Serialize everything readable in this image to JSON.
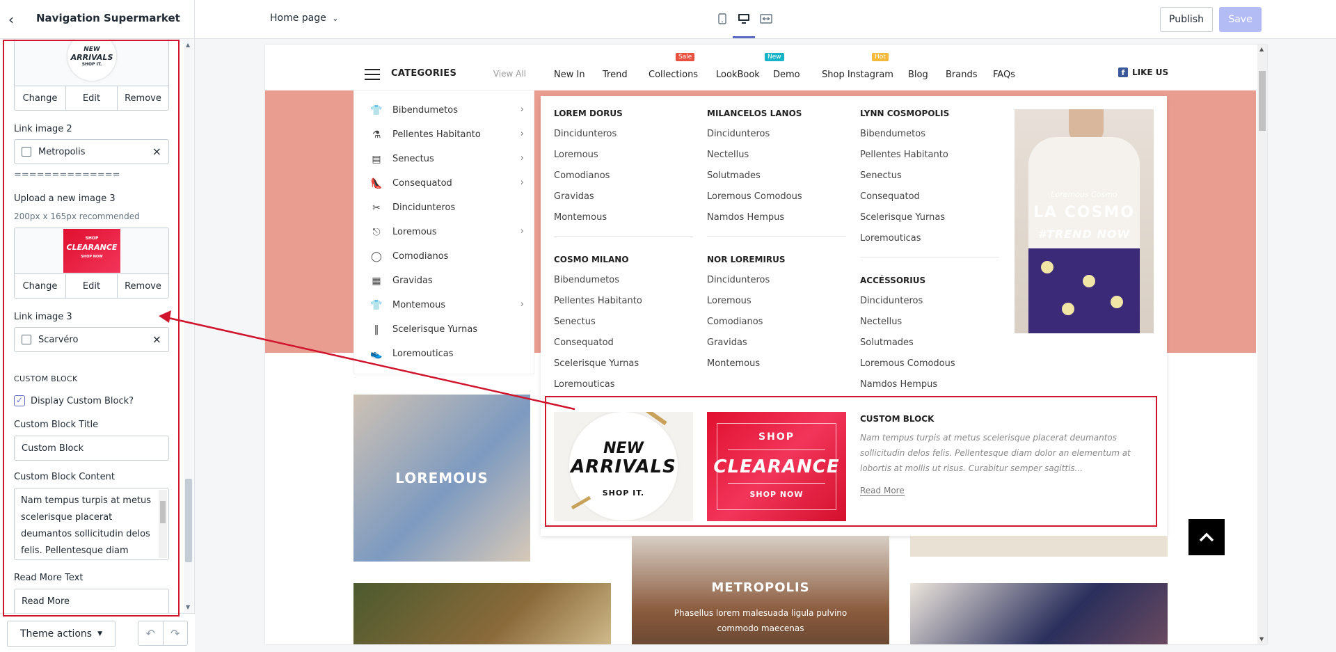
{
  "sidebar": {
    "title": "Navigation Supermarket",
    "image1_buttons": [
      "Change",
      "Edit",
      "Remove"
    ],
    "link_image_2_label": "Link image 2",
    "link_image_2_value": "Metropolis",
    "separator": "==============",
    "upload_image_3_label": "Upload a new image 3",
    "upload_image_3_hint": "200px x 165px recommended",
    "image3_buttons": [
      "Change",
      "Edit",
      "Remove"
    ],
    "link_image_3_label": "Link image 3",
    "link_image_3_value": "Scarvéro",
    "custom_block_heading": "CUSTOM BLOCK",
    "display_custom_block_label": "Display Custom Block?",
    "display_custom_block_checked": true,
    "custom_block_title_label": "Custom Block Title",
    "custom_block_title_value": "Custom Block",
    "custom_block_content_label": "Custom Block Content",
    "custom_block_content_value": "Nam tempus turpis at metus scelerisque placerat deumantos sollicitudin delos felis. Pellentesque diam dolor",
    "read_more_label": "Read More Text",
    "read_more_value": "Read More",
    "theme_actions": "Theme actions"
  },
  "topbar": {
    "page_select": "Home page",
    "publish": "Publish",
    "save": "Save",
    "active_device": "desktop"
  },
  "preview": {
    "categories_title": "CATEGORIES",
    "view_all": "View All",
    "categories": [
      {
        "label": "Bibendumetos",
        "arrow": true
      },
      {
        "label": "Pellentes Habitanto",
        "arrow": true
      },
      {
        "label": "Senectus",
        "arrow": true
      },
      {
        "label": "Consequatod",
        "arrow": true
      },
      {
        "label": "Dincidunteros",
        "arrow": false
      },
      {
        "label": "Loremous",
        "arrow": true
      },
      {
        "label": "Comodianos",
        "arrow": false
      },
      {
        "label": "Gravidas",
        "arrow": false
      },
      {
        "label": "Montemous",
        "arrow": true
      },
      {
        "label": "Scelerisque Yurnas",
        "arrow": false
      },
      {
        "label": "Loremouticas",
        "arrow": false
      }
    ],
    "nav": [
      {
        "label": "New In",
        "badge": ""
      },
      {
        "label": "Trend",
        "badge": ""
      },
      {
        "label": "Collections",
        "badge": "Sale"
      },
      {
        "label": "LookBook",
        "badge": ""
      },
      {
        "label": "Demo",
        "badge": "New"
      },
      {
        "label": "Shop Instagram",
        "badge": "Hot"
      },
      {
        "label": "Blog",
        "badge": ""
      },
      {
        "label": "Brands",
        "badge": ""
      },
      {
        "label": "FAQs",
        "badge": ""
      }
    ],
    "badge_colors": {
      "Sale": "#e8503f",
      "New": "#17b3c8",
      "Hot": "#f5b93b"
    },
    "like_us": "LIKE US",
    "mega_columns": [
      {
        "groups": [
          {
            "title": "LOREM DORUS",
            "items": [
              "Dincidunteros",
              "Loremous",
              "Comodianos",
              "Gravidas",
              "Montemous"
            ]
          },
          {
            "title": "COSMO MILANO",
            "items": [
              "Bibendumetos",
              "Pellentes Habitanto",
              "Senectus",
              "Consequatod",
              "Scelerisque Yurnas",
              "Loremouticas"
            ]
          }
        ]
      },
      {
        "groups": [
          {
            "title": "MILANCELOS LANOS",
            "items": [
              "Dincidunteros",
              "Nectellus",
              "Solutmades",
              "Loremous Comodous",
              "Namdos Hempus"
            ]
          },
          {
            "title": "NOR LOREMIRUS",
            "items": [
              "Dincidunteros",
              "Loremous",
              "Comodianos",
              "Gravidas",
              "Montemous"
            ]
          }
        ]
      },
      {
        "groups": [
          {
            "title": "LYNN COSMOPOLIS",
            "items": [
              "Bibendumetos",
              "Pellentes Habitanto",
              "Senectus",
              "Consequatod",
              "Scelerisque Yurnas",
              "Loremouticas"
            ]
          },
          {
            "title": "ACCÉSSORIUS",
            "items": [
              "Dincidunteros",
              "Nectellus",
              "Solutmades",
              "Loremous Comodous",
              "Namdos Hempus"
            ]
          }
        ]
      }
    ],
    "mega_image": {
      "small": "Loremous Cosmo",
      "big": "LA COSMO",
      "tag": "#TREND NOW"
    },
    "custom_block": {
      "img1": {
        "line1": "NEW",
        "line2": "ARRIVALS",
        "line3": "SHOP IT."
      },
      "img2": {
        "line1": "SHOP",
        "line2": "CLEARANCE",
        "line3": "SHOP NOW"
      },
      "title": "CUSTOM BLOCK",
      "text": "Nam tempus turpis at metus scelerisque placerat deumantos sollicitudin delos felis. Pellentesque diam dolor an elementum at lobortis at mollis ut risus. Curabitur semper sagittis...",
      "read_more": "Read More"
    },
    "tiles": {
      "loremous": "LOREMOUS",
      "metropolis": "METROPOLIS",
      "metropolis_sub": "Phasellus lorem malesuada ligula pulvino commodo maecenas"
    }
  }
}
